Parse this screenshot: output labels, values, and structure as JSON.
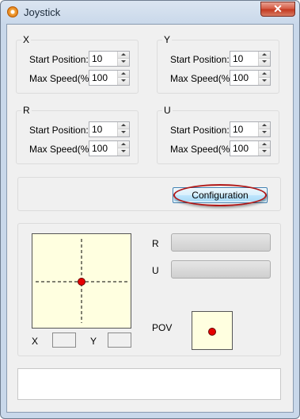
{
  "window": {
    "title": "Joystick",
    "icon": "app-joystick-icon",
    "close_label": "✕"
  },
  "axes": [
    {
      "label": "X",
      "start_label": "Start Position:",
      "start_value": "10",
      "speed_label": "Max Speed(%):",
      "speed_value": "100"
    },
    {
      "label": "Y",
      "start_label": "Start Position:",
      "start_value": "10",
      "speed_label": "Max Speed(%):",
      "speed_value": "100"
    },
    {
      "label": "R",
      "start_label": "Start Position:",
      "start_value": "10",
      "speed_label": "Max Speed(%):",
      "speed_value": "100"
    },
    {
      "label": "U",
      "start_label": "Start Position:",
      "start_value": "10",
      "speed_label": "Max Speed(%):",
      "speed_value": "100"
    }
  ],
  "config_button": {
    "label": "Configuration"
  },
  "monitor": {
    "x_label": "X",
    "y_label": "Y",
    "x_value": "",
    "y_value": "",
    "r_label": "R",
    "u_label": "U",
    "r_level": 0,
    "u_level": 0,
    "pov_label": "POV"
  },
  "colors": {
    "pad_background": "#ffffe0",
    "dot": "#e60000",
    "annotation_ellipse": "#b01818"
  },
  "status_text": ""
}
